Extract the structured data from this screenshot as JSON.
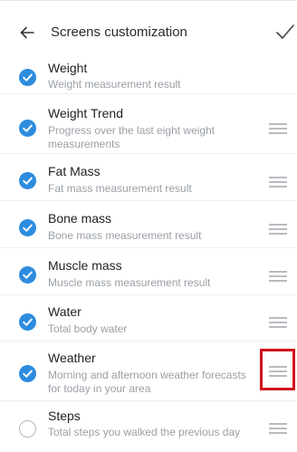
{
  "header": {
    "title": "Screens customization"
  },
  "items": [
    {
      "name": "Weight",
      "desc": "Weight measurement result",
      "checked": true,
      "draggable": false
    },
    {
      "name": "Weight Trend",
      "desc": "Progress over the last eight weight measurements",
      "checked": true,
      "draggable": true
    },
    {
      "name": "Fat Mass",
      "desc": "Fat mass measurement result",
      "checked": true,
      "draggable": true
    },
    {
      "name": "Bone mass",
      "desc": "Bone mass measurement result",
      "checked": true,
      "draggable": true
    },
    {
      "name": "Muscle mass",
      "desc": "Muscle mass measurement result",
      "checked": true,
      "draggable": true
    },
    {
      "name": "Water",
      "desc": "Total body water",
      "checked": true,
      "draggable": true
    },
    {
      "name": "Weather",
      "desc": "Morning and afternoon weather forecasts for today in your area",
      "checked": true,
      "draggable": true
    },
    {
      "name": "Steps",
      "desc": "Total steps you walked the previous day",
      "checked": false,
      "draggable": true
    }
  ],
  "colors": {
    "accent": "#2d8cde",
    "highlight": "#d3111e"
  }
}
